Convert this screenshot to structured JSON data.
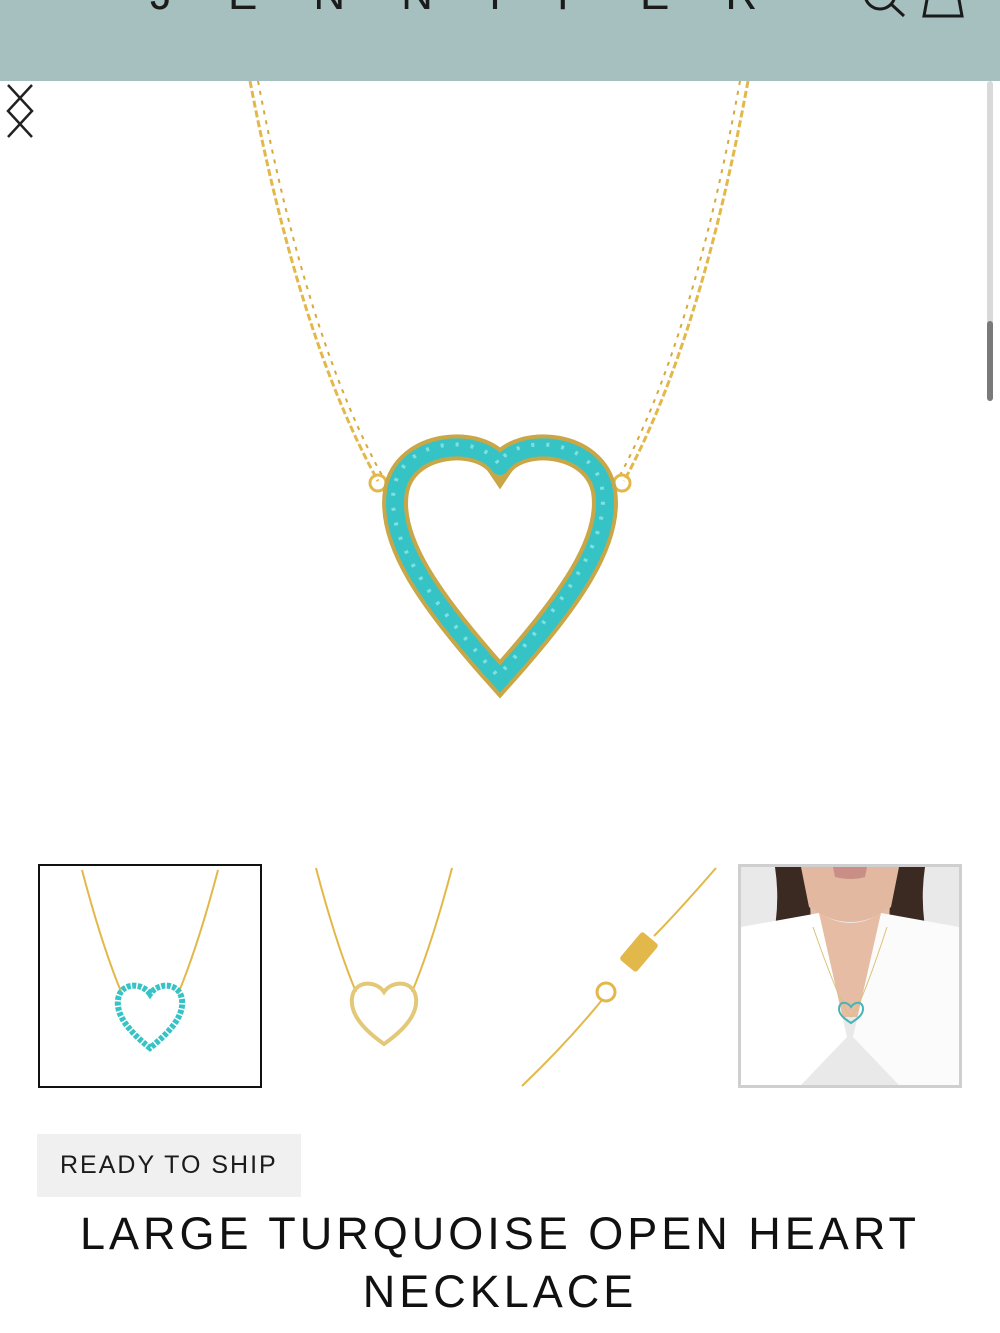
{
  "header": {
    "brand": "JENNIFER MEYER",
    "background": "#a6bfbf",
    "search_icon": "search-icon",
    "bag_icon": "shopping-bag-icon"
  },
  "gallery": {
    "prev_icon": "chevron-left-icon",
    "next_icon": "chevron-right-icon",
    "stone_color": "#35c3c6",
    "gold_color": "#e3b84a",
    "thumbnails": [
      {
        "name": "thumbnail-turquoise-heart",
        "selected": true
      },
      {
        "name": "thumbnail-gold-heart",
        "selected": false
      },
      {
        "name": "thumbnail-clasp-detail",
        "selected": false
      },
      {
        "name": "thumbnail-model-wearing",
        "selected": false
      }
    ]
  },
  "product": {
    "badge": "READY TO SHIP",
    "title": "LARGE TURQUOISE OPEN HEART NECKLACE"
  }
}
